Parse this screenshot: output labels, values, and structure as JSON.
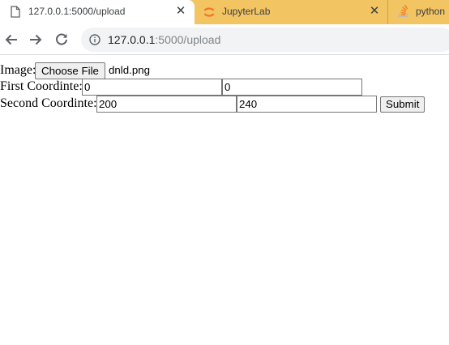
{
  "browser": {
    "tabs": [
      {
        "title": "127.0.0.1:5000/upload",
        "icon": "page-icon",
        "active": true
      },
      {
        "title": "JupyterLab",
        "icon": "jupyter-icon",
        "active": false
      },
      {
        "title": "python",
        "icon": "stackoverflow-icon",
        "active": false
      }
    ],
    "url_host": "127.0.0.1",
    "url_path": ":5000/upload",
    "colors": {
      "tabstrip": "#f3c462",
      "jupyter": "#f37626",
      "stackoverflow": "#f48024"
    }
  },
  "form": {
    "image_label": "Image:",
    "choose_file_label": "Choose File",
    "file_name": "dnld.png",
    "first_label": "First Coordinte:",
    "first_x": "0",
    "first_y": "0",
    "second_label": "Second Coordinte:",
    "second_x": "200",
    "second_y": "240",
    "submit_label": "Submit"
  }
}
